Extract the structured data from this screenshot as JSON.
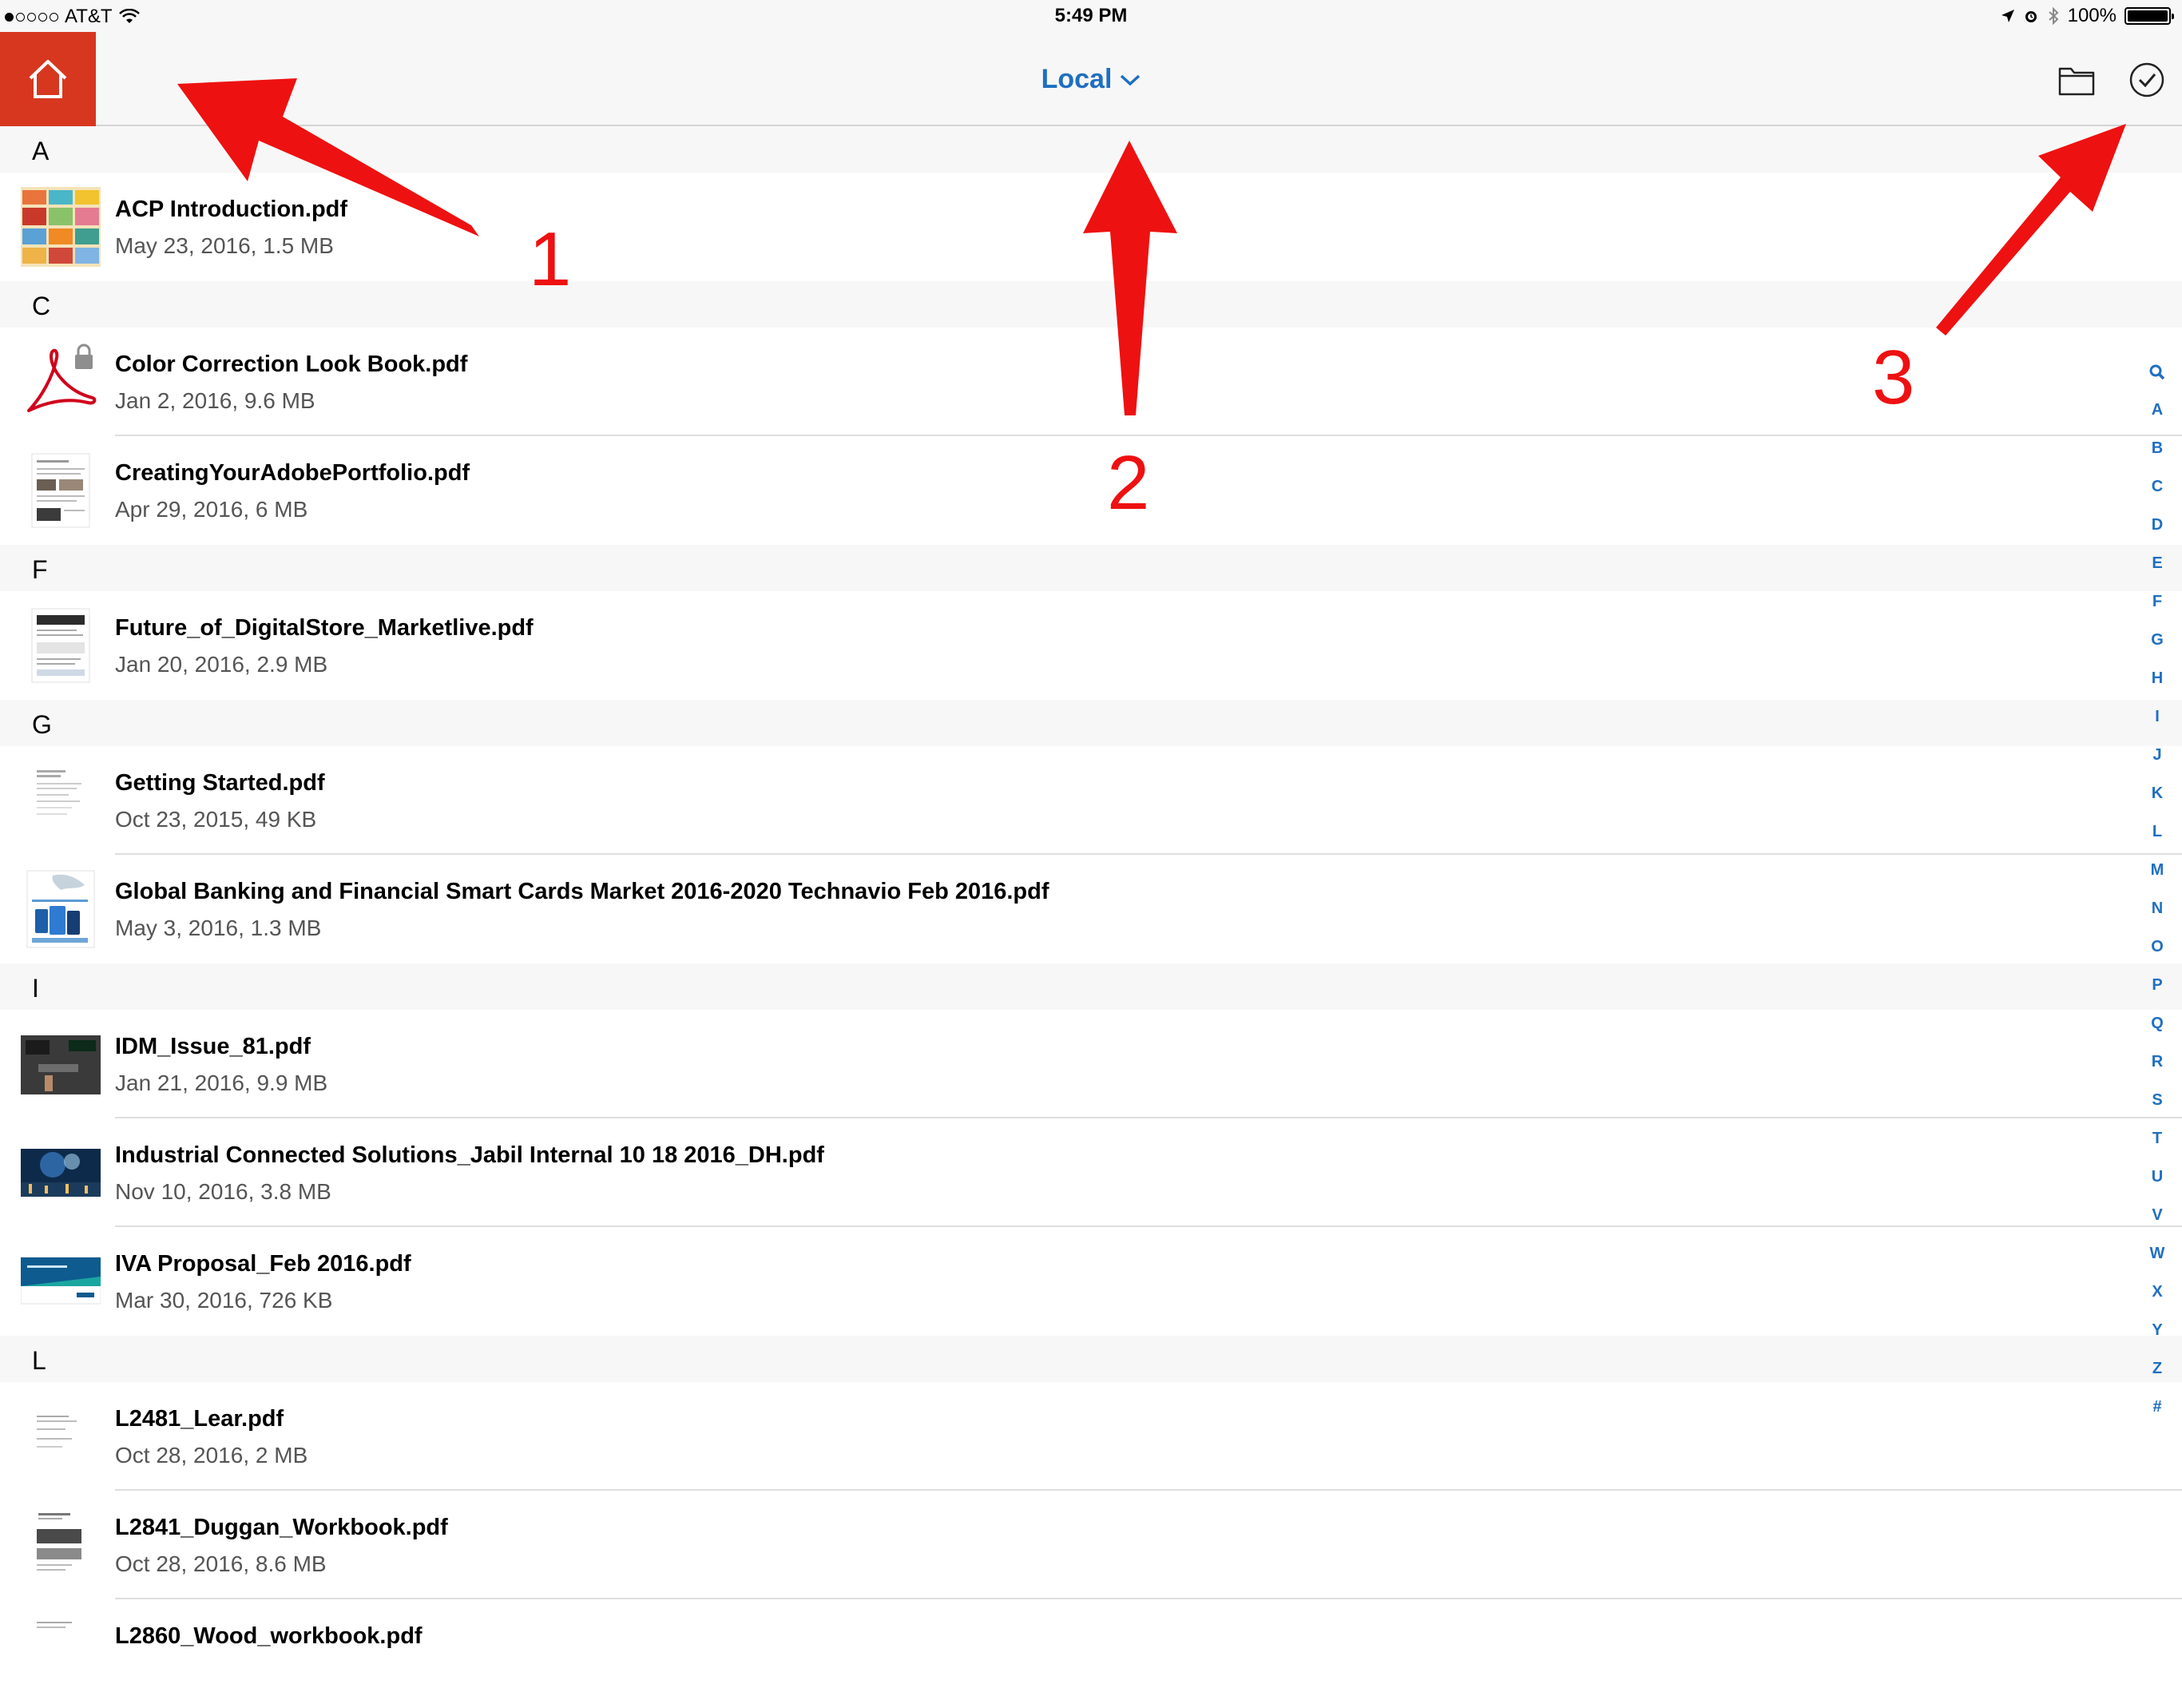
{
  "status_bar": {
    "carrier": "AT&T",
    "time": "5:49 PM",
    "battery": "100%"
  },
  "nav": {
    "title": "Local",
    "accent_color": "#1f6fc1",
    "home_color": "#d7371f",
    "icons": [
      "home-icon",
      "chevron-down-icon",
      "folder-icon",
      "checkmark-circle-icon"
    ]
  },
  "sections": [
    {
      "letter": "A",
      "files": [
        {
          "name": "ACP Introduction.pdf",
          "meta": "May 23, 2016, 1.5 MB",
          "thumb": "colorful-grid"
        }
      ]
    },
    {
      "letter": "C",
      "files": [
        {
          "name": "Color Correction Look Book.pdf",
          "meta": "Jan 2, 2016, 9.6 MB",
          "thumb": "acrobat-locked"
        },
        {
          "name": "CreatingYourAdobePortfolio.pdf",
          "meta": "Apr 29, 2016, 6 MB",
          "thumb": "doc-page"
        }
      ]
    },
    {
      "letter": "F",
      "files": [
        {
          "name": "Future_of_DigitalStore_Marketlive.pdf",
          "meta": "Jan 20, 2016, 2.9 MB",
          "thumb": "doc-page"
        }
      ]
    },
    {
      "letter": "G",
      "files": [
        {
          "name": "Getting Started.pdf",
          "meta": "Oct 23, 2015, 49 KB",
          "thumb": "doc-page-light"
        },
        {
          "name": "Global Banking and Financial Smart Cards Market 2016-2020 Technavio Feb 2016.pdf",
          "meta": "May 3, 2016, 1.3 MB",
          "thumb": "blue-cover"
        }
      ]
    },
    {
      "letter": "I",
      "files": [
        {
          "name": "IDM_Issue_81.pdf",
          "meta": "Jan 21, 2016, 9.9 MB",
          "thumb": "dark-slide"
        },
        {
          "name": "Industrial Connected Solutions_Jabil Internal 10 18 2016_DH.pdf",
          "meta": "Nov 10, 2016, 3.8 MB",
          "thumb": "night-city"
        },
        {
          "name": "IVA Proposal_Feb 2016.pdf",
          "meta": "Mar 30, 2016, 726 KB",
          "thumb": "teal-slide"
        }
      ]
    },
    {
      "letter": "L",
      "files": [
        {
          "name": "L2481_Lear.pdf",
          "meta": "Oct 28, 2016, 2 MB",
          "thumb": "doc-page-light"
        },
        {
          "name": "L2841_Duggan_Workbook.pdf",
          "meta": "Oct 28, 2016, 8.6 MB",
          "thumb": "doc-page"
        },
        {
          "name": "L2860_Wood_workbook.pdf",
          "meta": "",
          "thumb": "doc-page-light"
        }
      ]
    }
  ],
  "index_bar": [
    "search",
    "A",
    "B",
    "C",
    "D",
    "E",
    "F",
    "G",
    "H",
    "I",
    "J",
    "K",
    "L",
    "M",
    "N",
    "O",
    "P",
    "Q",
    "R",
    "S",
    "T",
    "U",
    "V",
    "W",
    "X",
    "Y",
    "Z",
    "#"
  ],
  "annotations": {
    "color": "#ee1111",
    "labels": [
      "1",
      "2",
      "3"
    ]
  }
}
